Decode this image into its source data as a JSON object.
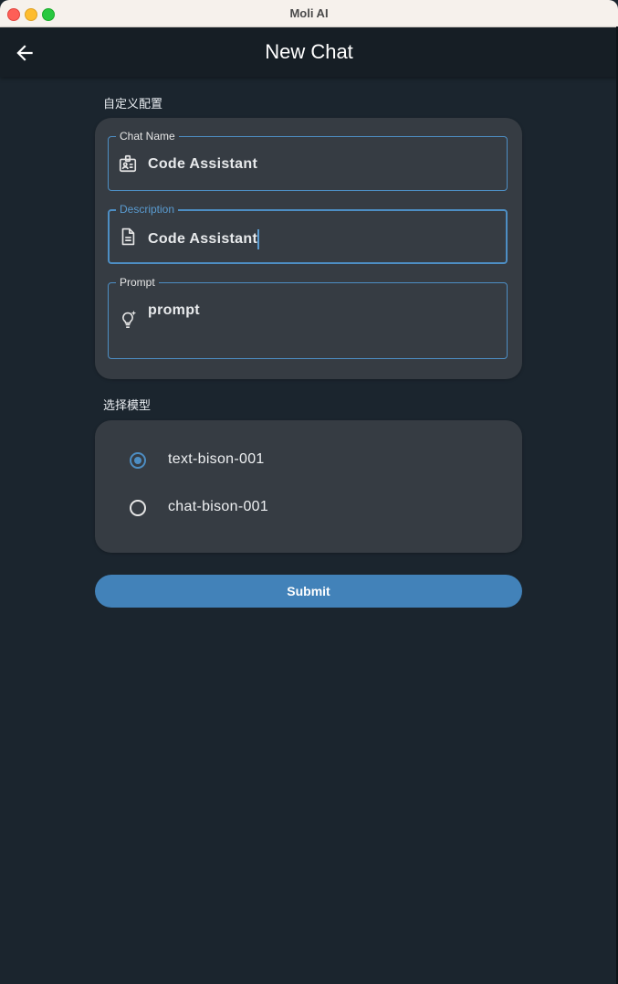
{
  "window": {
    "title": "Moli AI"
  },
  "appbar": {
    "title": "New Chat",
    "back_icon": "arrow-left-icon"
  },
  "custom_config": {
    "section_label": "自定义配置",
    "fields": {
      "chat_name": {
        "label": "Chat Name",
        "value": "Code Assistant",
        "icon": "id-badge-icon"
      },
      "description": {
        "label": "Description",
        "value": "Code Assistant",
        "icon": "document-icon"
      },
      "prompt": {
        "label": "Prompt",
        "value": "prompt",
        "icon": "lightbulb-sparkle-icon"
      }
    }
  },
  "model_select": {
    "section_label": "选择模型",
    "options": [
      {
        "label": "text-bison-001",
        "selected": true
      },
      {
        "label": "chat-bison-001",
        "selected": false
      }
    ]
  },
  "actions": {
    "submit_label": "Submit"
  },
  "colors": {
    "background": "#1b252e",
    "card": "#363c43",
    "accent": "#4d8ec4",
    "submit_button": "#4282b9"
  }
}
